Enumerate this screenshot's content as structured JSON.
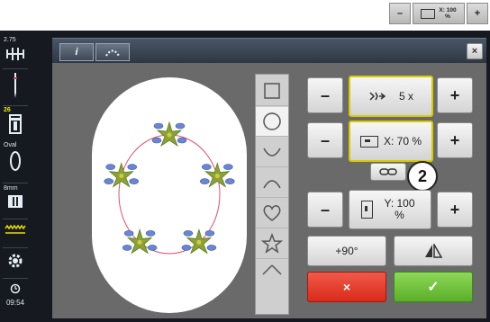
{
  "top_preview": {
    "minus": "–",
    "x_label": "X: 100 %",
    "plus": "+"
  },
  "sidebar": {
    "needle_size": "2.75",
    "bobbin_number": "26",
    "stitch_plate_label": "Oval",
    "hoop_size": "8mm",
    "clock": "09:54"
  },
  "header": {
    "tab1": "i",
    "tab2": "⌢",
    "close": "×"
  },
  "controls": {
    "rep_minus": "–",
    "rep_value": "5 x",
    "rep_plus": "+",
    "x_minus": "–",
    "x_value": "X: 70 %",
    "x_plus": "+",
    "annotation": "2",
    "y_minus": "–",
    "y_value": "Y: 100 %",
    "y_plus": "+",
    "rotate": "+90°",
    "cancel": "×",
    "confirm": "✓"
  },
  "shapes": [
    "square",
    "circle",
    "arc-down",
    "arc-up",
    "heart",
    "star"
  ],
  "colors": {
    "highlight": "#d8cc00",
    "cancel": "#e0402f",
    "confirm": "#6cc13a",
    "guide_line": "#e05070"
  }
}
